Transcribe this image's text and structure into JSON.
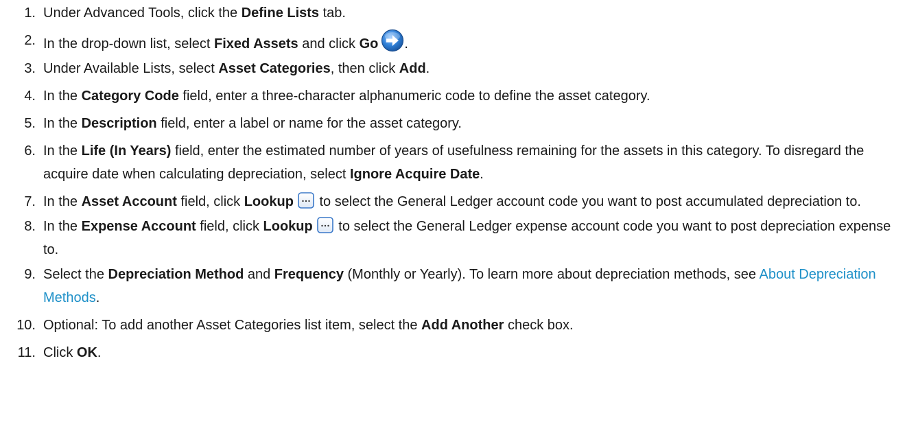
{
  "steps": [
    {
      "n": "1.",
      "parts": [
        {
          "t": "Under Advanced Tools, click the "
        },
        {
          "t": "Define Lists",
          "b": true
        },
        {
          "t": " tab."
        }
      ]
    },
    {
      "n": "2.",
      "parts": [
        {
          "t": "In the drop-down list, select "
        },
        {
          "t": "Fixed Assets",
          "b": true
        },
        {
          "t": " and click "
        },
        {
          "t": "Go",
          "b": true
        },
        {
          "icon": "go-arrow-icon"
        },
        {
          "t": "."
        }
      ]
    },
    {
      "n": "3.",
      "parts": [
        {
          "t": "Under Available Lists, select "
        },
        {
          "t": "Asset Categories",
          "b": true
        },
        {
          "t": ", then click "
        },
        {
          "t": "Add",
          "b": true
        },
        {
          "t": "."
        }
      ]
    },
    {
      "n": "4.",
      "parts": [
        {
          "t": "In the "
        },
        {
          "t": "Category Code",
          "b": true
        },
        {
          "t": " field, enter a three-character alphanumeric code to define the asset category."
        }
      ]
    },
    {
      "n": "5.",
      "parts": [
        {
          "t": "In the "
        },
        {
          "t": "Description",
          "b": true
        },
        {
          "t": " field, enter a label or name for the asset category."
        }
      ]
    },
    {
      "n": "6.",
      "parts": [
        {
          "t": "In the "
        },
        {
          "t": "Life (In Years)",
          "b": true
        },
        {
          "t": " field, enter the estimated number of years of usefulness remaining for the assets in this category. To disregard the acquire date when calculating depreciation, select "
        },
        {
          "t": "Ignore Acquire Date",
          "b": true
        },
        {
          "t": "."
        }
      ]
    },
    {
      "n": "7.",
      "parts": [
        {
          "t": "In the "
        },
        {
          "t": "Asset Account",
          "b": true
        },
        {
          "t": " field, click "
        },
        {
          "t": "Lookup",
          "b": true
        },
        {
          "icon": "lookup-icon"
        },
        {
          "t": " to select the General Ledger account code you want to post accumulated depreciation to."
        }
      ]
    },
    {
      "n": "8.",
      "parts": [
        {
          "t": "In the "
        },
        {
          "t": "Expense Account",
          "b": true
        },
        {
          "t": " field, click "
        },
        {
          "t": "Lookup",
          "b": true
        },
        {
          "icon": "lookup-icon"
        },
        {
          "t": " to select the General Ledger expense account code you want to post depreciation expense to."
        }
      ]
    },
    {
      "n": "9.",
      "parts": [
        {
          "t": "Select the "
        },
        {
          "t": "Depreciation Method",
          "b": true
        },
        {
          "t": " and "
        },
        {
          "t": "Frequency",
          "b": true
        },
        {
          "t": " (Monthly or Yearly). To learn more about depreciation methods, see "
        },
        {
          "t": "About Depreciation Methods",
          "link": true
        },
        {
          "t": "."
        }
      ]
    },
    {
      "n": "10.",
      "parts": [
        {
          "t": "Optional: To add another Asset Categories list item, select the "
        },
        {
          "t": "Add Another",
          "b": true
        },
        {
          "t": " check box."
        }
      ]
    },
    {
      "n": "11.",
      "parts": [
        {
          "t": "Click "
        },
        {
          "t": "OK",
          "b": true
        },
        {
          "t": "."
        }
      ]
    }
  ],
  "colors": {
    "text": "#1a1a1a",
    "link": "#1e90c8",
    "go_icon_blue": "#2f7fd6",
    "lookup_icon_blue": "#3b79c9"
  }
}
